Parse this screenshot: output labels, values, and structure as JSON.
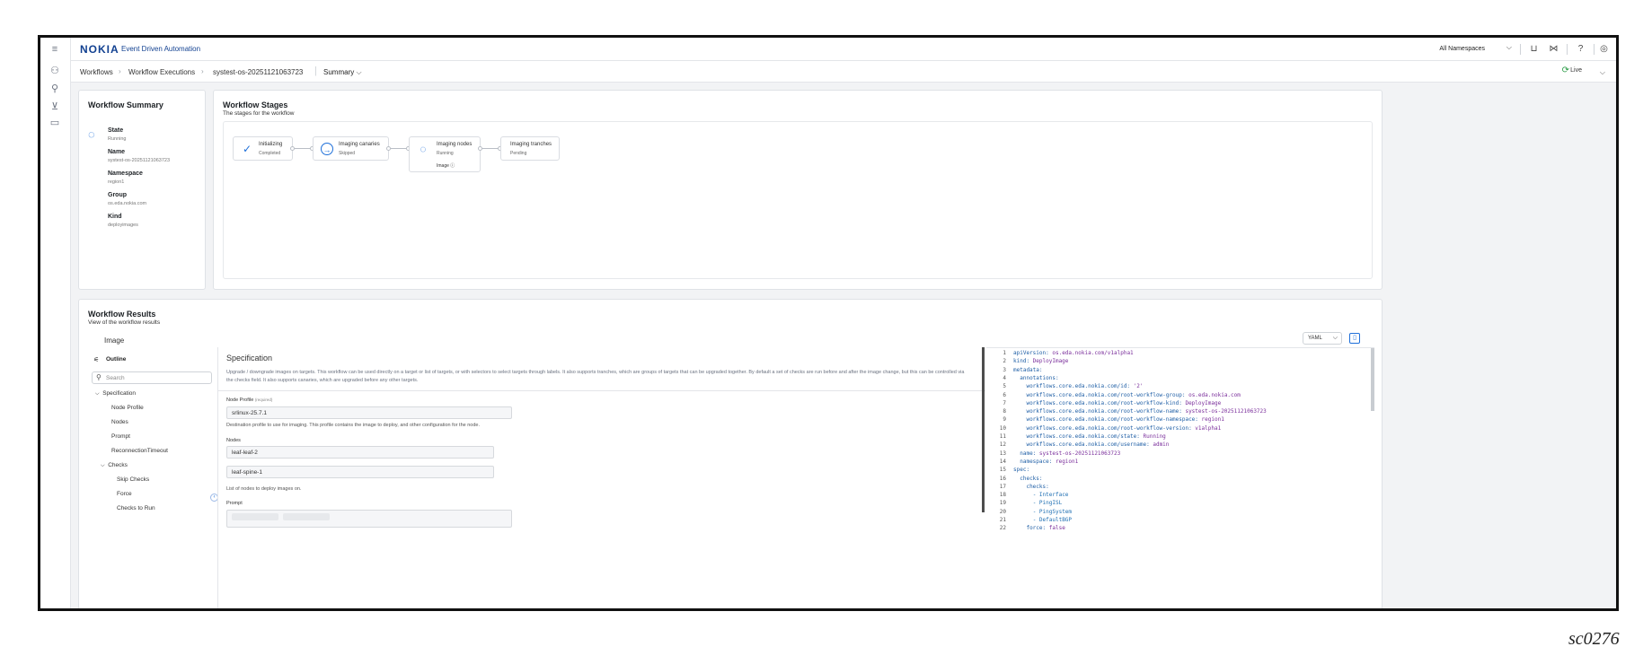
{
  "app": {
    "logo": "NOKIA",
    "product": "Event Driven Automation"
  },
  "topbar": {
    "namespace": "All Namespaces"
  },
  "breadcrumb": {
    "items": [
      "Workflows",
      "Workflow Executions",
      "systest-os-20251121063723"
    ],
    "view": "Summary",
    "live": "Live"
  },
  "summary": {
    "title": "Workflow Summary",
    "state_label": "State",
    "state": "Running",
    "name_label": "Name",
    "name": "systest-os-20251121063723",
    "namespace_label": "Namespace",
    "namespace": "region1",
    "group_label": "Group",
    "group": "os.eda.nokia.com",
    "kind_label": "Kind",
    "kind": "deployimages"
  },
  "stages": {
    "title": "Workflow Stages",
    "subtitle": "The stages for the workflow",
    "items": [
      {
        "name": "Initializing",
        "status": "Completed"
      },
      {
        "name": "Imaging canaries",
        "status": "Skipped"
      },
      {
        "name": "Imaging nodes",
        "status": "Running",
        "extra": "Image"
      },
      {
        "name": "Imaging tranches",
        "status": "Pending"
      }
    ]
  },
  "results": {
    "title": "Workflow Results",
    "subtitle": "View of the workflow results",
    "tab": "Image",
    "format": "YAML",
    "outline_title": "Outline",
    "search_placeholder": "Search",
    "outline": [
      "Specification",
      "Node Profile",
      "Nodes",
      "Prompt",
      "ReconnectionTimeout",
      "Checks",
      "Skip Checks",
      "Force",
      "Checks to Run"
    ],
    "spec_title": "Specification",
    "spec_desc": "Upgrade / downgrade images on targets. This workflow can be used directly on a target or list of targets, or with selectors to select targets through labels. It also supports tranches, which are groups of targets that can be upgraded together. By default a set of checks are run before and after the image change, but this can be controlled via the checks field. It also supports canaries, which are upgraded before any other targets.",
    "node_profile_label": "Node Profile",
    "node_profile_required": "(required)",
    "node_profile_value": "srlinux-25.7.1",
    "node_profile_help": "Destination profile to use for imaging. This profile contains the image to deploy, and other configuration for the node.",
    "nodes_label": "Nodes",
    "nodes": [
      "leaf-leaf-2",
      "leaf-spine-1"
    ],
    "nodes_help": "List of nodes to deploy images on.",
    "prompt_label": "Prompt"
  },
  "yaml": [
    {
      "n": "1",
      "k": "apiVersion",
      "v": "os.eda.nokia.com/v1alpha1",
      "i": 0
    },
    {
      "n": "2",
      "k": "kind",
      "v": "DeployImage",
      "i": 0
    },
    {
      "n": "3",
      "k": "metadata",
      "v": "",
      "i": 0
    },
    {
      "n": "4",
      "k": "annotations",
      "v": "",
      "i": 1
    },
    {
      "n": "5",
      "k": "workflows.core.eda.nokia.com/id",
      "v": "'2'",
      "i": 2
    },
    {
      "n": "6",
      "k": "workflows.core.eda.nokia.com/root-workflow-group",
      "v": "os.eda.nokia.com",
      "i": 2
    },
    {
      "n": "7",
      "k": "workflows.core.eda.nokia.com/root-workflow-kind",
      "v": "DeployImage",
      "i": 2
    },
    {
      "n": "8",
      "k": "workflows.core.eda.nokia.com/root-workflow-name",
      "v": "systest-os-20251121063723",
      "i": 2
    },
    {
      "n": "9",
      "k": "workflows.core.eda.nokia.com/root-workflow-namespace",
      "v": "region1",
      "i": 2
    },
    {
      "n": "10",
      "k": "workflows.core.eda.nokia.com/root-workflow-version",
      "v": "v1alpha1",
      "i": 2
    },
    {
      "n": "11",
      "k": "workflows.core.eda.nokia.com/state",
      "v": "Running",
      "i": 2
    },
    {
      "n": "12",
      "k": "workflows.core.eda.nokia.com/username",
      "v": "admin",
      "i": 2
    },
    {
      "n": "13",
      "k": "name",
      "v": "systest-os-20251121063723",
      "i": 1
    },
    {
      "n": "14",
      "k": "namespace",
      "v": "region1",
      "i": 1
    },
    {
      "n": "15",
      "k": "spec",
      "v": "",
      "i": 0
    },
    {
      "n": "16",
      "k": "checks",
      "v": "",
      "i": 1
    },
    {
      "n": "17",
      "k": "checks",
      "v": "",
      "i": 2
    },
    {
      "n": "18",
      "k": "- Interface",
      "v": "",
      "i": 3
    },
    {
      "n": "19",
      "k": "- PingISL",
      "v": "",
      "i": 3
    },
    {
      "n": "20",
      "k": "- PingSystem",
      "v": "",
      "i": 3
    },
    {
      "n": "21",
      "k": "- DefaultBGP",
      "v": "",
      "i": 3
    },
    {
      "n": "22",
      "k": "force",
      "v": "false",
      "i": 2
    }
  ],
  "footer_label": "sc0276"
}
